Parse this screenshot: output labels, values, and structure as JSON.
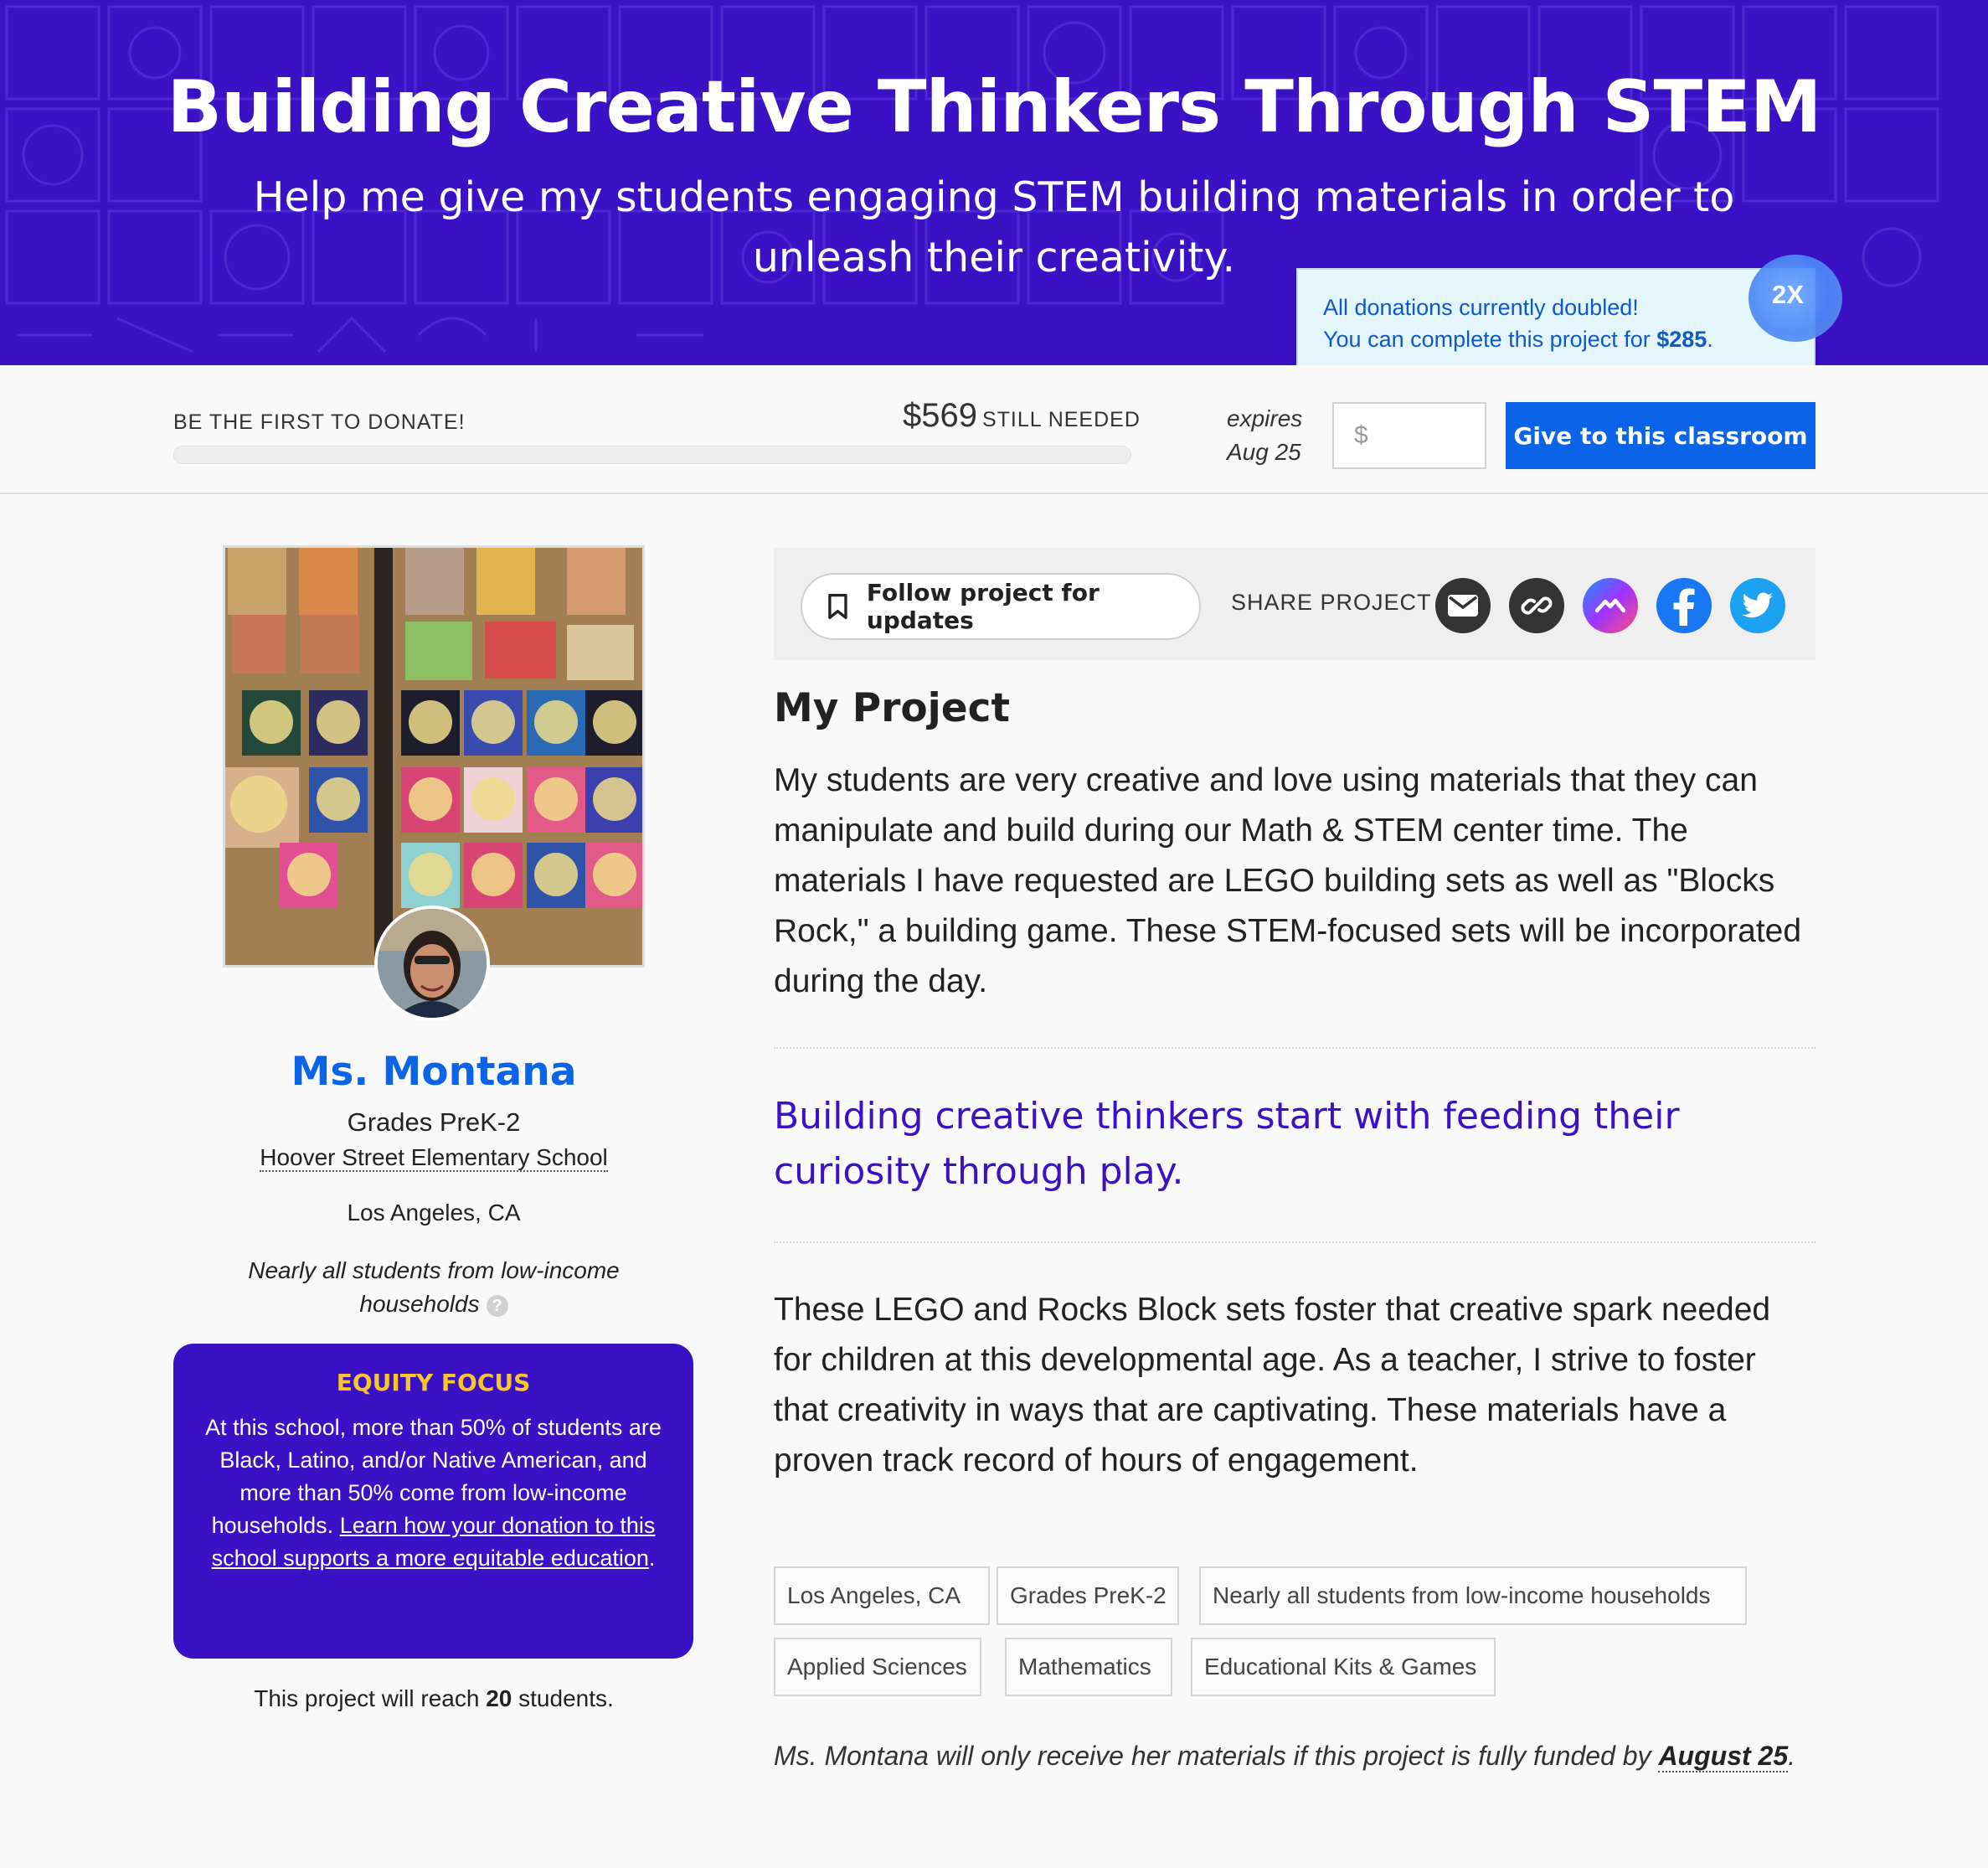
{
  "hero": {
    "title": "Building Creative Thinkers Through STEM",
    "subtitle": "Help me give my students engaging STEM building materials in order to unleash their creativity.",
    "background_color": "#3a11c4"
  },
  "match_offer": {
    "line1": "All donations currently doubled!",
    "line2_prefix": "You can complete this project for ",
    "line2_amount": "$285",
    "line2_suffix": ".",
    "badge": "2X"
  },
  "donate": {
    "first_label": "BE THE FIRST TO DONATE!",
    "needed_amount": "$569",
    "needed_label": "STILL NEEDED",
    "progress_fraction": 0,
    "expires_label": "expires",
    "expires_date": "Aug 25",
    "amount_placeholder": "$",
    "give_label": "Give to this classroom",
    "accent_color": "#0b63e7"
  },
  "teacher": {
    "name": "Ms. Montana",
    "grades": "Grades PreK-2",
    "school": "Hoover Street Elementary School",
    "location": "Los Angeles, CA",
    "income": "Nearly all students from low-income households",
    "help_icon": "question-icon"
  },
  "equity": {
    "title": "EQUITY FOCUS",
    "body": "At this school, more than 50% of students are Black, Latino, and/or Native American, and more than 50% come from low-income households. ",
    "link": "Learn how your donation to this school supports a more equitable education",
    "end": "."
  },
  "reach": {
    "prefix": "This project will reach ",
    "count": "20",
    "suffix": " students."
  },
  "actions": {
    "follow_label": "Follow project for updates",
    "share_label": "SHARE PROJECT",
    "share_icons": [
      "email-icon",
      "link-icon",
      "messenger-icon",
      "facebook-icon",
      "twitter-icon"
    ]
  },
  "project": {
    "heading": "My Project",
    "paragraph1": "My students are very creative and love using materials that they can manipulate and build during our Math & STEM center time. The materials I have requested are LEGO building sets as well as \"Blocks Rock,\" a building game. These STEM-focused sets will be incorporated during the day.",
    "quote": "Building creative thinkers start with feeding their curiosity through play.",
    "paragraph2": "These LEGO and Rocks Block sets foster that creative spark needed for children at this developmental age. As a teacher, I strive to foster that creativity in ways that are captivating. These materials have a proven track record of hours of engagement."
  },
  "tags": [
    "Los Angeles, CA",
    "Grades PreK-2",
    "Nearly all students from low-income households",
    "Applied Sciences",
    "Mathematics",
    "Educational Kits & Games"
  ],
  "funding_note": {
    "text": "Ms. Montana will only receive her materials if this project is fully funded by ",
    "date": "August 25",
    "end": "."
  }
}
